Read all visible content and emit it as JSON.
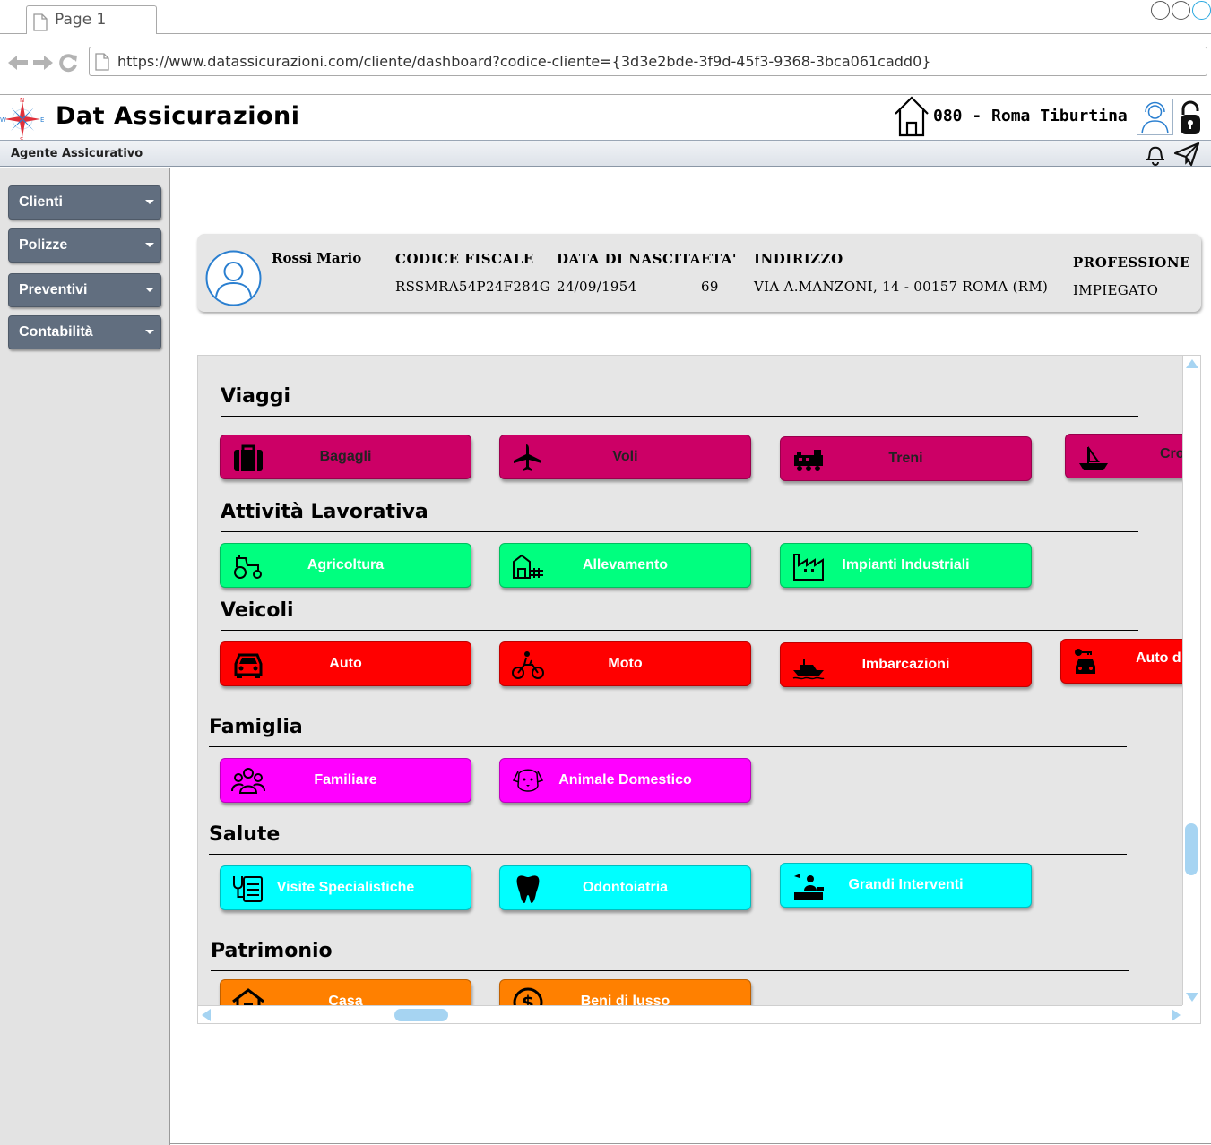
{
  "browser": {
    "tab_title": "Page 1",
    "url": "https://www.datassicurazioni.com/cliente/dashboard?codice-cliente={3d3e2bde-3f9d-45f3-9368-3bca061cadd0}"
  },
  "header": {
    "app_title": "Dat Assicurazioni",
    "branch": "080 - Roma Tiburtina",
    "role": "Agente Assicurativo"
  },
  "sidebar": {
    "items": [
      {
        "label": "Clienti"
      },
      {
        "label": "Polizze"
      },
      {
        "label": "Preventivi"
      },
      {
        "label": "Contabilità"
      }
    ]
  },
  "client": {
    "name": "Rossi Mario",
    "fields": [
      {
        "label": "CODICE FISCALE",
        "value": "RSSMRA54P24F284G"
      },
      {
        "label": "DATA DI NASCITA",
        "value": "24/09/1954"
      },
      {
        "label": "ETA'",
        "value": "69"
      },
      {
        "label": "INDIRIZZO",
        "value": "VIA A.MANZONI, 14 - 00157 ROMA (RM)"
      },
      {
        "label": "PROFESSIONE",
        "value": "IMPIEGATO"
      }
    ]
  },
  "sections": [
    {
      "title": "Viaggi",
      "color": "#cc0066",
      "tiles": [
        {
          "label": "Bagagli",
          "icon": "suitcase-icon"
        },
        {
          "label": "Voli",
          "icon": "airplane-icon"
        },
        {
          "label": "Treni",
          "icon": "train-icon"
        },
        {
          "label": "Cro",
          "icon": "ship-icon"
        }
      ]
    },
    {
      "title": "Attività Lavorativa",
      "color": "#00ff7f",
      "tiles": [
        {
          "label": "Agricoltura",
          "icon": "tractor-icon"
        },
        {
          "label": "Allevamento",
          "icon": "barn-icon"
        },
        {
          "label": "Impianti Industriali",
          "icon": "factory-icon"
        }
      ]
    },
    {
      "title": "Veicoli",
      "color": "#ff0000",
      "tiles": [
        {
          "label": "Auto",
          "icon": "car-icon"
        },
        {
          "label": "Moto",
          "icon": "motorcycle-icon"
        },
        {
          "label": "Imbarcazioni",
          "icon": "boat-icon"
        },
        {
          "label": "Auto d",
          "icon": "car-key-icon"
        }
      ]
    },
    {
      "title": "Famiglia",
      "color": "#ff00ff",
      "tiles": [
        {
          "label": "Familiare",
          "icon": "family-icon"
        },
        {
          "label": "Animale Domestico",
          "icon": "dog-icon"
        }
      ]
    },
    {
      "title": "Salute",
      "color": "#00ffff",
      "tiles": [
        {
          "label": "Visite Specialistiche",
          "icon": "stethoscope-icon"
        },
        {
          "label": "Odontoiatria",
          "icon": "tooth-icon"
        },
        {
          "label": "Grandi Interventi",
          "icon": "surgery-icon"
        }
      ]
    },
    {
      "title": "Patrimonio",
      "color": "#ff8000",
      "tiles": [
        {
          "label": "Casa",
          "icon": "house-icon"
        },
        {
          "label": "Beni di lusso",
          "icon": "money-icon"
        }
      ]
    }
  ]
}
